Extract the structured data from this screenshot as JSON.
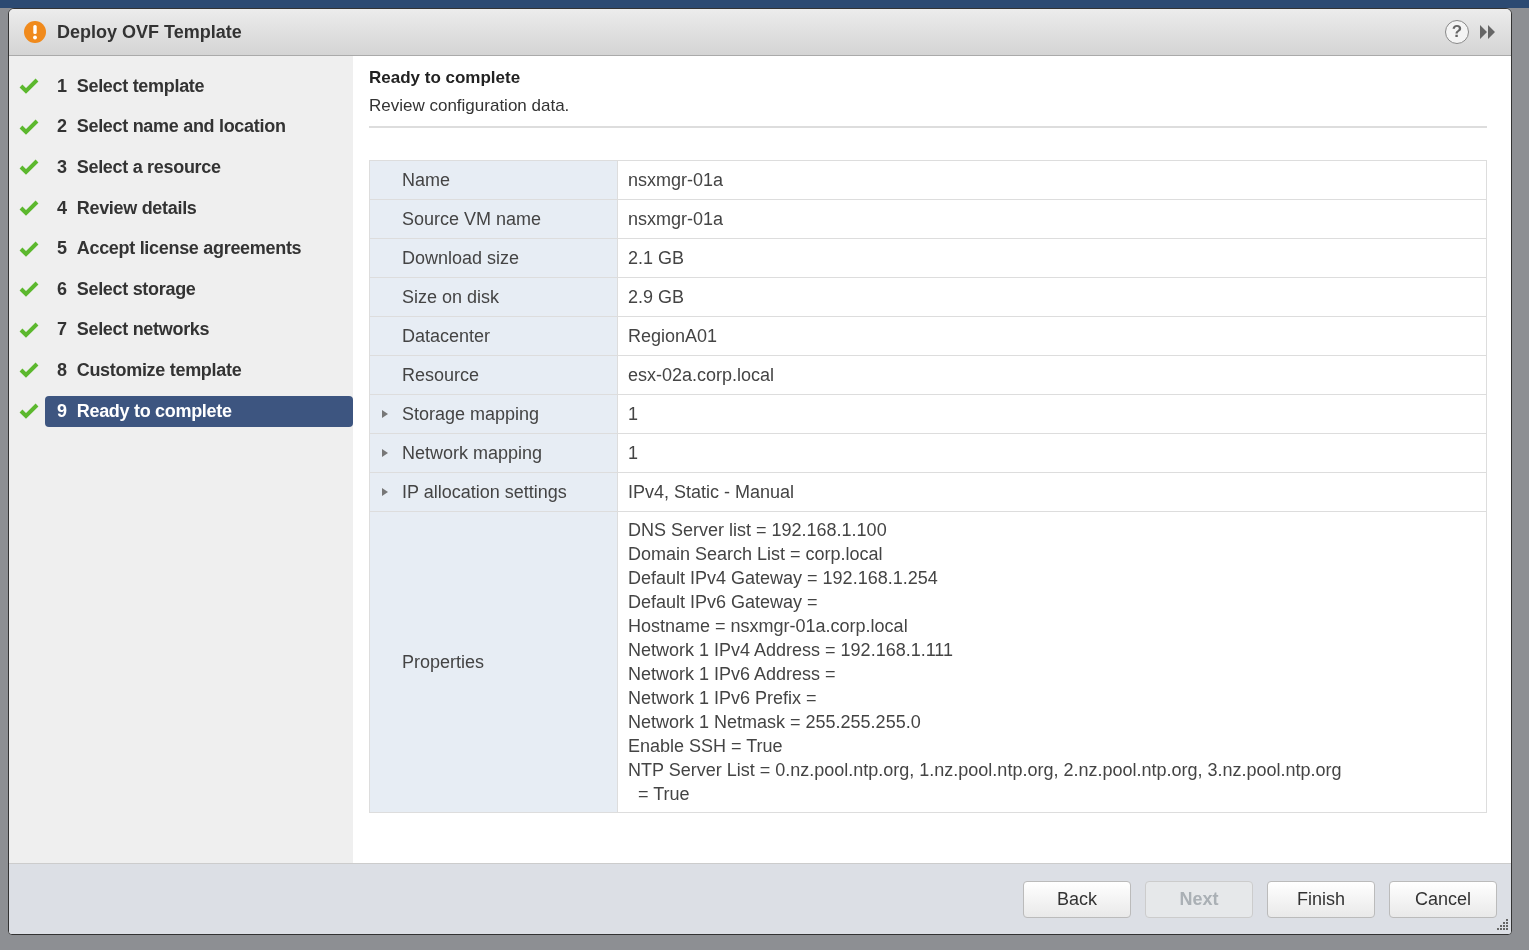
{
  "window": {
    "title": "Deploy OVF Template",
    "help": "?"
  },
  "steps": [
    {
      "number": "1",
      "label": "Select template",
      "completed": true,
      "selected": false
    },
    {
      "number": "2",
      "label": "Select name and location",
      "completed": true,
      "selected": false
    },
    {
      "number": "3",
      "label": "Select a resource",
      "completed": true,
      "selected": false
    },
    {
      "number": "4",
      "label": "Review details",
      "completed": true,
      "selected": false
    },
    {
      "number": "5",
      "label": "Accept license agreements",
      "completed": true,
      "selected": false
    },
    {
      "number": "6",
      "label": "Select storage",
      "completed": true,
      "selected": false
    },
    {
      "number": "7",
      "label": "Select networks",
      "completed": true,
      "selected": false
    },
    {
      "number": "8",
      "label": "Customize template",
      "completed": true,
      "selected": false
    },
    {
      "number": "9",
      "label": "Ready to complete",
      "completed": true,
      "selected": true
    }
  ],
  "page": {
    "title": "Ready to complete",
    "subtitle": "Review configuration data."
  },
  "table": {
    "rows": [
      {
        "kind": "text",
        "label": "Name",
        "expandable": false,
        "value": "nsxmgr-01a"
      },
      {
        "kind": "text",
        "label": "Source VM name",
        "expandable": false,
        "value": "nsxmgr-01a"
      },
      {
        "kind": "text",
        "label": "Download size",
        "expandable": false,
        "value": "2.1 GB"
      },
      {
        "kind": "text",
        "label": "Size on disk",
        "expandable": false,
        "value": "2.9 GB"
      },
      {
        "kind": "text",
        "label": "Datacenter",
        "expandable": false,
        "value": "RegionA01"
      },
      {
        "kind": "text",
        "label": "Resource",
        "expandable": false,
        "value": "esx-02a.corp.local"
      },
      {
        "kind": "text",
        "label": "Storage mapping",
        "expandable": true,
        "value": "1"
      },
      {
        "kind": "text",
        "label": "Network mapping",
        "expandable": true,
        "value": "1"
      },
      {
        "kind": "text",
        "label": "IP allocation settings",
        "expandable": true,
        "value": "IPv4, Static - Manual"
      },
      {
        "kind": "lines",
        "label": "Properties",
        "expandable": false,
        "lines": [
          "DNS Server list = 192.168.1.100",
          "Domain Search List = corp.local",
          "Default IPv4 Gateway = 192.168.1.254",
          "Default IPv6 Gateway =",
          "Hostname = nsxmgr-01a.corp.local",
          "Network 1 IPv4 Address = 192.168.1.111",
          "Network 1 IPv6 Address =",
          "Network 1 IPv6 Prefix =",
          "Network 1 Netmask = 255.255.255.0",
          "Enable SSH = True",
          "NTP Server List = 0.nz.pool.ntp.org, 1.nz.pool.ntp.org, 2.nz.pool.ntp.org, 3.nz.pool.ntp.org",
          "  = True"
        ]
      }
    ]
  },
  "buttons": [
    {
      "label": "Back",
      "disabled": false
    },
    {
      "label": "Next",
      "disabled": true
    },
    {
      "label": "Finish",
      "disabled": false
    },
    {
      "label": "Cancel",
      "disabled": false
    }
  ]
}
